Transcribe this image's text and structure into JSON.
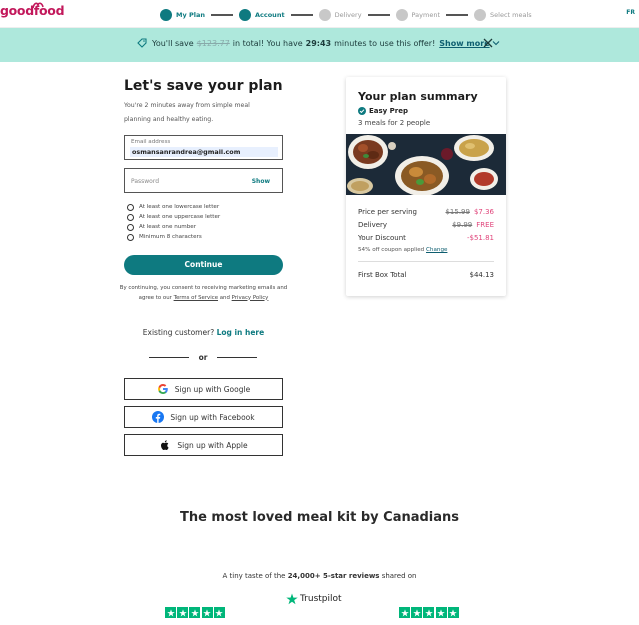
{
  "header": {
    "logo": "goodfood",
    "lang": "FR",
    "steps": [
      "My Plan",
      "Account",
      "Delivery",
      "Payment",
      "Select meals"
    ]
  },
  "banner": {
    "prefix": "You'll save",
    "original_amount": "$123.77",
    "suffix1": "in total! You have",
    "timer": "29:43",
    "suffix2": "minutes to use this offer!",
    "show_more": "Show more"
  },
  "form": {
    "title": "Let's save your plan",
    "subtitle": "You're 2 minutes away from simple meal planning and healthy eating.",
    "email_label": "Email address",
    "email_value": "osmansanrandrea@gmail.com",
    "password_placeholder": "Password",
    "show_label": "Show",
    "rules": [
      "At least one lowercase letter",
      "At least one uppercase letter",
      "At least one number",
      "Minimum 8 characters"
    ],
    "continue_label": "Continue",
    "consent_text": "By continuing, you consent to receiving marketing emails and agree to our",
    "tos": "Terms of Service",
    "and": "and",
    "privacy": "Privacy Policy",
    "existing_text": "Existing customer?",
    "login_label": "Log in here",
    "or_label": "or",
    "google_label": "Sign up with Google",
    "facebook_label": "Sign up with Facebook",
    "apple_label": "Sign up with Apple"
  },
  "summary": {
    "title": "Your plan summary",
    "plan_name": "Easy Prep",
    "meals": "3 meals for 2 people",
    "price_label": "Price per serving",
    "price_old": "$15.99",
    "price_new": "$7.36",
    "delivery_label": "Delivery",
    "delivery_old": "$9.99",
    "delivery_new": "FREE",
    "discount_label": "Your Discount",
    "discount_value": "-$51.81",
    "coupon_text": "54% off coupon applied",
    "change_label": "Change",
    "total_label": "First Box Total",
    "total_value": "$44.13"
  },
  "bottom": {
    "headline": "The most loved meal kit by Canadians",
    "taste_prefix": "A tiny taste of the",
    "taste_bold": "24,000+ 5-star reviews",
    "taste_suffix": "shared on",
    "trustpilot": "Trustpilot"
  },
  "colors": {
    "brand_teal": "#0e7a80",
    "banner_bg": "#aee8dc",
    "logo_pink": "#c2185b",
    "price_pink": "#e0457b",
    "trustpilot_green": "#00b67a"
  }
}
